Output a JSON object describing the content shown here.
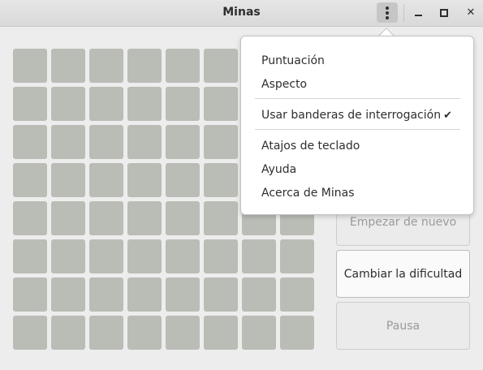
{
  "window": {
    "title": "Minas"
  },
  "titlebar": {
    "menu_icon": "vertical-ellipsis-icon",
    "minimize_icon": "minimize-icon",
    "maximize_icon": "maximize-icon",
    "close_icon": "close-icon",
    "close_glyph": "✕"
  },
  "board": {
    "rows": 8,
    "cols": 8
  },
  "buttons": {
    "start_new": "Empezar de nuevo",
    "change_difficulty": "Cambiar la dificultad",
    "pause": "Pausa"
  },
  "menu": {
    "items": [
      "Puntuación",
      "Aspecto",
      "Usar banderas de interrogación",
      "Atajos de teclado",
      "Ayuda",
      "Acerca de Minas"
    ],
    "checked_item": "Usar banderas de interrogación",
    "check_glyph": "✔"
  }
}
